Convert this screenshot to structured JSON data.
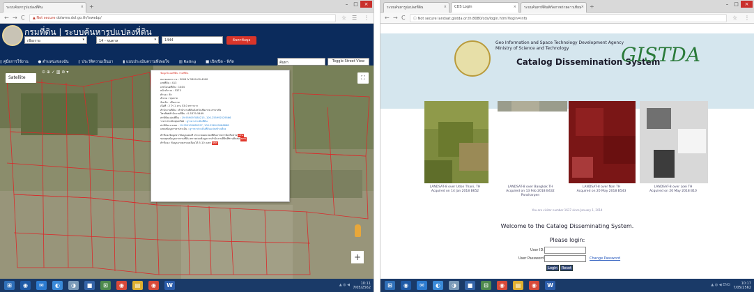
{
  "left": {
    "tabs": [
      {
        "label": "ระบบค้นหารูปแปลงที่ดิน",
        "close": "×"
      }
    ],
    "new_tab": "+",
    "window_controls": [
      "–",
      "□",
      "×"
    ],
    "nav": {
      "back": "←",
      "forward": "→",
      "reload": "C"
    },
    "address": {
      "warning": "▲ Not secure",
      "url": "dolwms.dol.go.th/tvwebp/"
    },
    "header": {
      "title": "กรมที่ดิน | ระบบค้นหารูปแปลงที่ดิน",
      "province": "เชียงราย",
      "district": "14 - ขุนตาล",
      "parcel_no": "1444",
      "search_button": "ค้นหาข้อมูล"
    },
    "menu": [
      "คู่มือการใช้งาน",
      "ตำแหน่งของฉัน",
      "ประวัติความเป็นมา",
      "แบบประเมินความพึงพอใจ",
      "Rating",
      "เปิด/ปิด - พิกัด"
    ],
    "street_search": "ค้นหา",
    "toggle_street": "Toggle Street View",
    "map": {
      "satellite": "Satellite",
      "tool_icons": "⊙ ⊕ ✓ ▥ ⊘ ▾",
      "fullscreen": "⛶",
      "zoom": "+"
    },
    "popup": {
      "header": "ข้อมูลโฉนดที่ดิน กรมที่ดิน",
      "lines": [
        "หมายเลขระวาง : 5048 IV 2699-00-4000",
        "เลขที่ดิน : 413",
        "เลขโฉนดที่ดิน : 1444",
        "หน้าสำรวจ : 5373",
        "ตำบล : ต้า",
        "อำเภอ : ขุนตาล",
        "จังหวัด : เชียงราย",
        "เนื้อที่ : 2 ไร่ 1 งาน 53.0 ตารางวา",
        "สำนักงานที่ดิน : สำนักงานที่ดินจังหวัดเชียงราย สาขาเทิง",
        "โทรศัพท์สำนักงานที่ดิน : 0-5379-5469"
      ],
      "coords1_label": "ค่าพิกัดแปลงที่ดิน : ",
      "coords1_value": "19.959097080215, 100.255992529566",
      "price_line": "ราคาประเมินทุนทรัพย์ : ",
      "price_value": "ดูราคาประเมินที่ดิน",
      "coords2_label": "ค่าพิกัดแนวเขต : ",
      "coords2_value": "19.959105680297, 100.256109086888",
      "extra_line": "แสดงข้อมูลราคาประเมิน : ",
      "extra_value": "ดูราคาประเมินที่ดินแปลงข้างเคียง",
      "notes": [
        "คำชี้แจงข้อมูลจากข้อมูลแผนที่ ประมวลผลแปลงที่ดินจากสถานีเครือข่าย",
        "ขอบคุณข้อมูลจากกรมที่ดิน ตรวจสอบข้อมูลจากสำนักงานที่ดินที่ท่านติดต่อ",
        "คำชี้แจง: ข้อมูลอาจคลาดเคลื่อนได้ 5-10 เมตร"
      ],
      "new_tag": "NEW"
    },
    "taskbar_icons": [
      "⊞",
      "◉",
      "✉",
      "◐",
      "◑",
      "■",
      "⊡",
      "◉",
      "▤",
      "◉",
      "W"
    ],
    "tray": "▲ ◍ ◀",
    "clock": {
      "time": "10:11",
      "date": "7/05/2562"
    }
  },
  "right": {
    "tabs": [
      {
        "label": "ระบบค้นหารูปแปลงที่ดิน",
        "close": "×"
      },
      {
        "label": "CDS Login",
        "close": "×"
      },
      {
        "label": "ระบบค้นหาที่ดินพิกัดภาพถ่ายดาวเทียม",
        "close": "×"
      }
    ],
    "new_tab": "+",
    "window_controls": [
      "–",
      "□",
      "×"
    ],
    "nav": {
      "back": "←",
      "forward": "→",
      "reload": "C"
    },
    "address": {
      "info": "ⓘ Not secure",
      "url": "landsat.gistda.or.th:8080/cds/login.html?login=info"
    },
    "banner": {
      "agency": "Geo Information and Space Technology Development Agency",
      "ministry": "Ministry of Science and Technology",
      "system": "Catalog Dissemination System",
      "brand": "GISTDA"
    },
    "images": [
      {
        "caption": "LANDSAT-8 over Udon Thani, TH",
        "acquired": "Acquired on 14 Jan 2018 B652"
      },
      {
        "caption": "LANDSAT-8 over Bangkok TH",
        "acquired": "Acquired on 13 Feb 2018 B432 Pansharpen"
      },
      {
        "caption": "LANDSAT-8 over Nan TH",
        "acquired": "Acquired on 20 May 2018 B543"
      },
      {
        "caption": "LANDSAT-8 over Loei TH",
        "acquired": "Acquired on 20 May 2018 B10"
      }
    ],
    "visitors": "You are visitor number 1637 since January 1, 2014",
    "welcome": "Welcome to the Catalog Disseminating System.",
    "please_login": "Please login:",
    "user_id_label": "User ID:",
    "password_label": "User Password:",
    "change_password": "Change Password",
    "login_button": "Login",
    "reset_button": "Reset",
    "taskbar_icons": [
      "⊞",
      "◉",
      "✉",
      "◐",
      "◑",
      "■",
      "⊡",
      "◉",
      "▤",
      "◉",
      "W"
    ],
    "tray": "▲ ◍ ◀ ENG",
    "clock": {
      "time": "10:17",
      "date": "7/05/2562"
    }
  },
  "colors": {
    "header_navy": "#0b2b5c",
    "search_red": "#d9352a",
    "taskbar": "#1a3a68",
    "parcel_lines": "#d92a2a",
    "gistda_green": "#2a7a3a"
  }
}
